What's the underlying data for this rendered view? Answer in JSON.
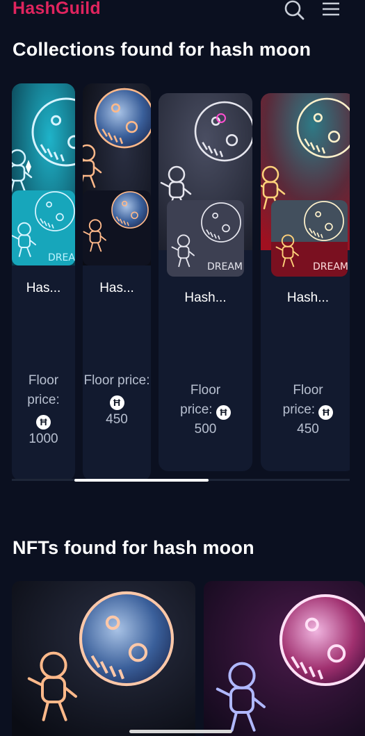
{
  "app": {
    "brand": "HashGuild",
    "brand_color": "#e0245e"
  },
  "header": {
    "search_icon": "search-icon",
    "menu_icon": "hamburger-menu-icon"
  },
  "collections": {
    "title": "Collections found for hash moon",
    "items": [
      {
        "name": "Has...",
        "floor_label": "Floor price:",
        "price": "1000",
        "currency_icon": "hbar-icon"
      },
      {
        "name": "Has...",
        "floor_label": "Floor price:",
        "price": "450",
        "currency_icon": "hbar-icon"
      },
      {
        "name": "Hash...",
        "floor_label": "Floor price:",
        "price": "500",
        "currency_icon": "hbar-icon"
      },
      {
        "name": "Hash...",
        "floor_label": "Floor price:",
        "price": "450",
        "currency_icon": "hbar-icon"
      }
    ],
    "scroll_position": 0.25
  },
  "nfts": {
    "title": "NFTs found for hash moon"
  },
  "images": {
    "dream_text": "DREAM"
  }
}
